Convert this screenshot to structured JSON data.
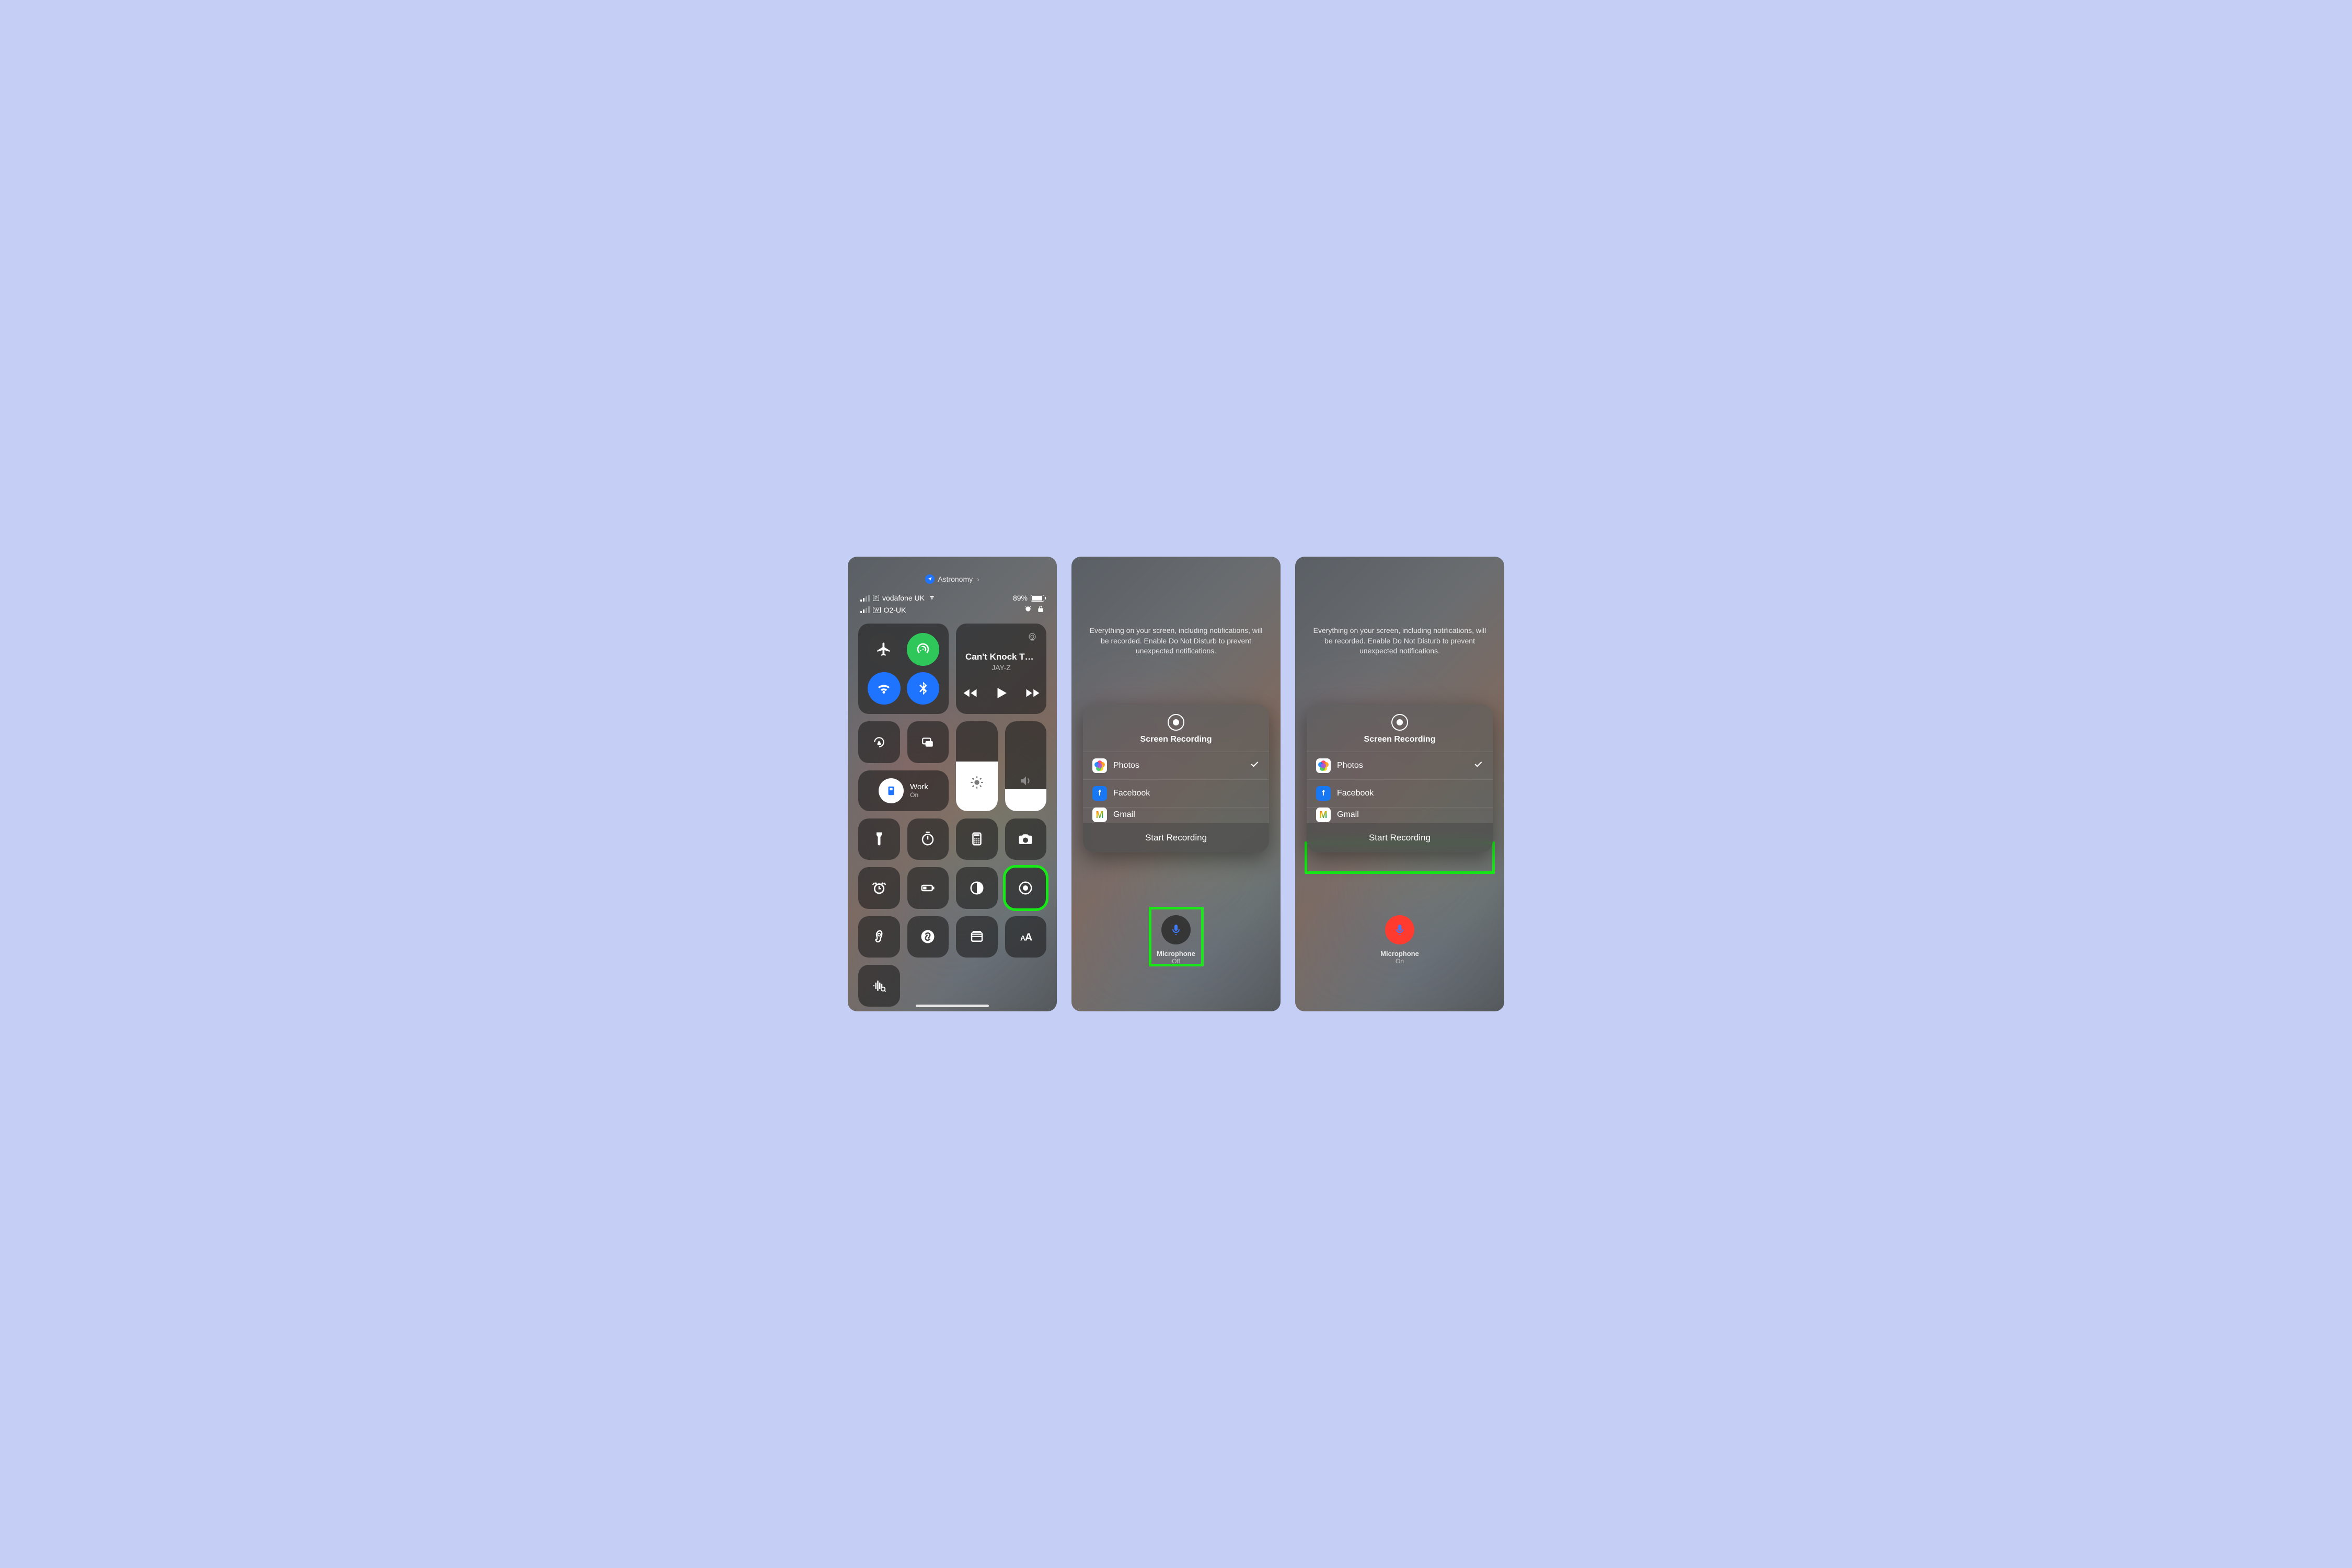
{
  "screen1": {
    "pill_app": "Astronomy",
    "carrier1": "vodafone UK",
    "carrier2": "O2-UK",
    "sim1_badge": "P",
    "sim2_badge": "W",
    "battery_pct": "89%",
    "nowplaying": {
      "title": "Can't Knock Th…",
      "artist": "JAY-Z"
    },
    "focus": {
      "name": "Work",
      "state": "On"
    }
  },
  "recording": {
    "info": "Everything on your screen, including notifications, will be recorded. Enable Do Not Disturb to prevent unexpected notifications.",
    "sheet_title": "Screen Recording",
    "apps": {
      "photos": "Photos",
      "facebook": "Facebook",
      "gmail": "Gmail"
    },
    "start_btn": "Start Recording",
    "mic_label": "Microphone",
    "mic_off": "Off",
    "mic_on": "On"
  }
}
